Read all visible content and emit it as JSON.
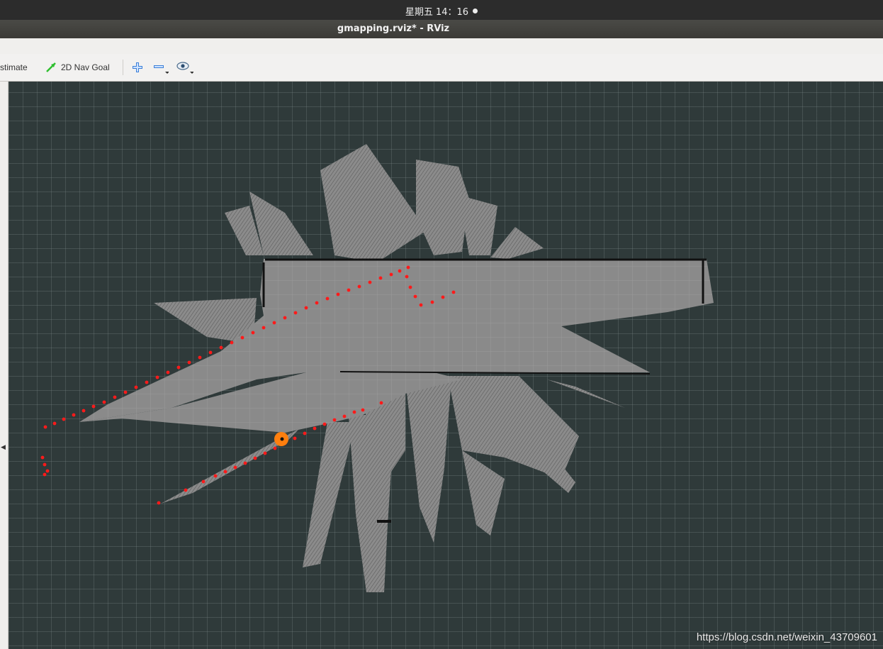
{
  "system_bar": {
    "clock": "星期五 14：16"
  },
  "window": {
    "title": "gmapping.rviz* - RViz"
  },
  "toolbar": {
    "pose_estimate_label": "stimate",
    "nav_goal_label": "2D Nav Goal"
  },
  "watermark": "https://blog.csdn.net/weixin_43709601",
  "colors": {
    "scan": "#ff1a1a",
    "robot": "#ff7f0e",
    "map_free": "#8b8b8b",
    "background": "#2f3a3a",
    "grid": "#5f6b6b"
  }
}
